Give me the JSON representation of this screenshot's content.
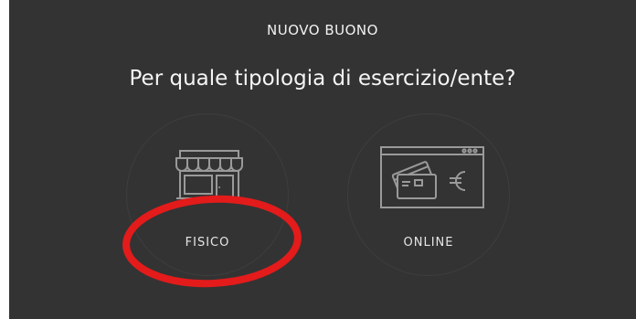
{
  "header": {
    "title": "NUOVO BUONO"
  },
  "prompt": {
    "question": "Per quale tipologia di esercizio/ente?"
  },
  "options": [
    {
      "label": "FISICO",
      "icon": "storefront-icon"
    },
    {
      "label": "ONLINE",
      "icon": "browser-payment-icon"
    }
  ],
  "annotation": {
    "type": "red-ellipse",
    "target": "FISICO",
    "color": "#e31b1b"
  },
  "colors": {
    "background": "#333333",
    "icon": "#9a9a9a",
    "text": "#f2f2f2"
  }
}
